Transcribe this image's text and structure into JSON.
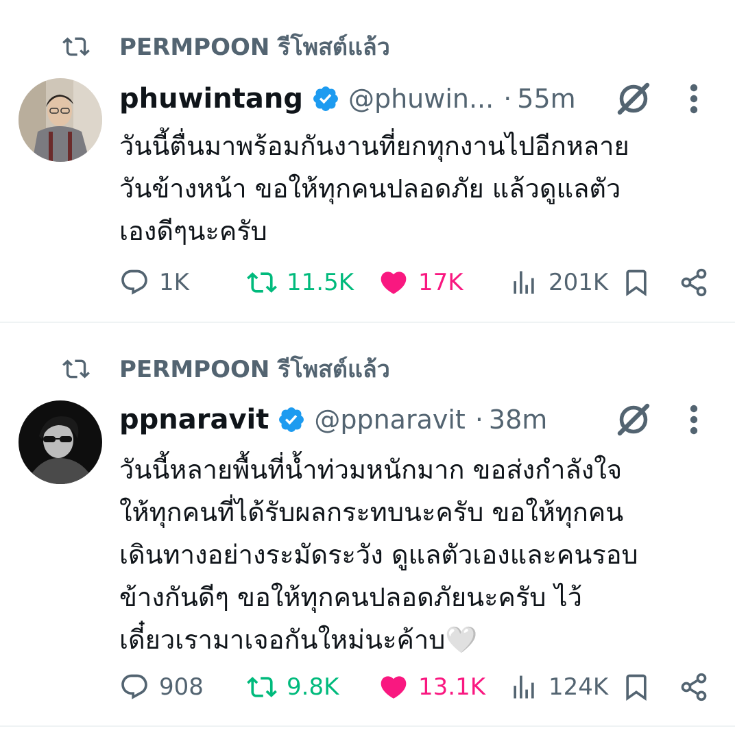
{
  "tweets": [
    {
      "repost_text": "PERMPOON รีโพสต์แล้ว",
      "name": "phuwintang",
      "handle": "@phuwin...",
      "dot": "·",
      "time": "55m",
      "lines": [
        "วันนี้ตื่นมาพร้อมกันงานที่ยกทุกงานไปอีกหลาย",
        "วันข้างหน้า ขอให้ทุกคนปลอดภัย แล้วดูแลตัว",
        "เองดีๆนะครับ"
      ],
      "replies": "1K",
      "reposts": "11.5K",
      "likes": "17K",
      "views": "201K"
    },
    {
      "repost_text": "PERMPOON รีโพสต์แล้ว",
      "name": "ppnaravit",
      "handle": "@ppnaravit",
      "dot": "·",
      "time": "38m",
      "lines": [
        "วันนี้หลายพื้นที่น้ำท่วมหนักมาก ขอส่งกำลังใจ",
        "ให้ทุกคนที่ได้รับผลกระทบนะครับ ขอให้ทุกคน",
        "เดินทางอย่างระมัดระวัง ดูแลตัวเองและคนรอบ",
        "ข้างกันดีๆ ขอให้ทุกคนปลอดภัยนะครับ  ไว้",
        "เดี๋ยวเรามาเจอกันใหม่นะค้าบ🤍"
      ],
      "replies": "908",
      "reposts": "9.8K",
      "likes": "13.1K",
      "views": "124K"
    }
  ],
  "icons": [
    "repost-icon",
    "verified-badge-icon",
    "grok-icon",
    "more-icon",
    "reply-icon",
    "like-icon",
    "views-icon",
    "bookmark-icon",
    "share-icon"
  ],
  "colors": {
    "muted": "#536471",
    "repost": "#00ba7c",
    "like": "#f91880",
    "verified": "#1d9bf0",
    "divider": "#eff3f4"
  }
}
